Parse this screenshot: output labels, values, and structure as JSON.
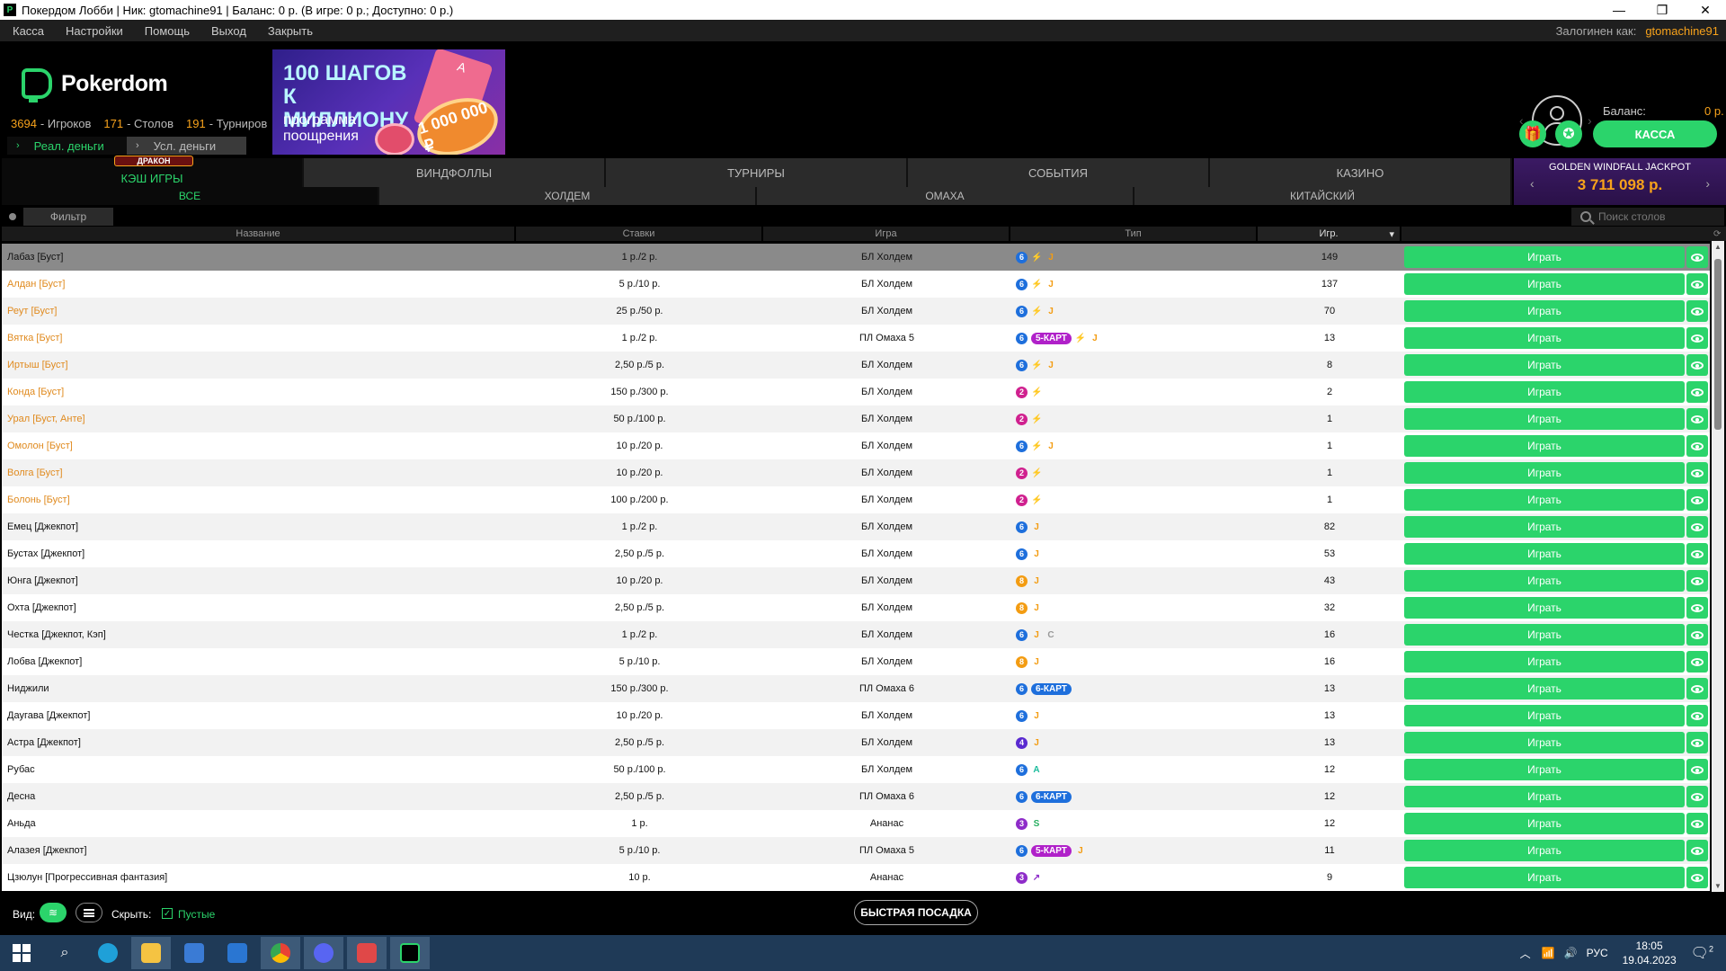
{
  "window": {
    "title": "Покердом Лобби | Ник: gtomachine91 | Баланс: 0 р. (В игре: 0 р.; Доступно: 0 р.)",
    "minimize": "—",
    "restore": "❐",
    "close": "✕"
  },
  "menu": {
    "items": [
      "Касса",
      "Настройки",
      "Помощь",
      "Выход",
      "Закрыть"
    ],
    "logged_in_label": "Залогинен как:",
    "username": "gtomachine91"
  },
  "header": {
    "logo_text": "Pokerdom",
    "stats": {
      "players_count": "3694",
      "players_label": "- Игроков",
      "tables_count": "171",
      "tables_label": "- Столов",
      "tournaments_count": "191",
      "tournaments_label": "- Турниров"
    },
    "money_tabs": [
      "Реал. деньги",
      "Усл. деньги"
    ],
    "banner": {
      "line1": "100 ШАГОВ К МИЛЛИОНУ",
      "line2": "программа поощрения",
      "chip_text": "1 000 000 ₽",
      "card_text": "A"
    },
    "balance_label": "Баланс:",
    "balance_value": "0 р.",
    "balance_bar_value": "0",
    "kassa_label": "КАССА"
  },
  "game_tabs": {
    "dragon_badge": "ДРАКОН",
    "tabs": [
      "КЭШ ИГРЫ",
      "ВИНДФОЛЛЫ",
      "ТУРНИРЫ",
      "СОБЫТИЯ",
      "КАЗИНО"
    ]
  },
  "jackpot": {
    "title": "GOLDEN WINDFALL JACKPOT",
    "value": "3 711 098 р."
  },
  "sub_tabs": [
    "ВСЕ",
    "ХОЛДЕМ",
    "ОМАХА",
    "КИТАЙСКИЙ"
  ],
  "filter": {
    "label": "Фильтр",
    "search_placeholder": "Поиск столов"
  },
  "columns": {
    "name": "Название",
    "stakes": "Ставки",
    "game": "Игра",
    "type": "Тип",
    "players": "Игр.",
    "sort_marker": "▾"
  },
  "play_label": "Играть",
  "colors": {
    "accent": "#2bd46b",
    "orange": "#f7a21b",
    "badge_blue": "#1e6fdc",
    "badge_pink": "#d0218f",
    "badge_orange": "#f39c12",
    "badge_purple": "#8e2cc9",
    "badge_indigo": "#5a2ad0"
  },
  "tables": [
    {
      "name": "Лабаз [Буст]",
      "stakes": "1 р./2 р.",
      "game": "БЛ Холдем",
      "players": "149",
      "orange": false,
      "selected": true,
      "num": "6",
      "numColor": "#1e6fdc",
      "tags": [
        {
          "t": "⚡",
          "c": "#e0392b"
        },
        {
          "t": "J",
          "c": "#f39c12"
        }
      ]
    },
    {
      "name": "Алдан [Буст]",
      "stakes": "5 р./10 р.",
      "game": "БЛ Холдем",
      "players": "137",
      "orange": true,
      "selected": false,
      "num": "6",
      "numColor": "#1e6fdc",
      "tags": [
        {
          "t": "⚡",
          "c": "#e0392b"
        },
        {
          "t": "J",
          "c": "#f39c12"
        }
      ]
    },
    {
      "name": "Реут [Буст]",
      "stakes": "25 р./50 р.",
      "game": "БЛ Холдем",
      "players": "70",
      "orange": true,
      "selected": false,
      "num": "6",
      "numColor": "#1e6fdc",
      "tags": [
        {
          "t": "⚡",
          "c": "#e0392b"
        },
        {
          "t": "J",
          "c": "#f39c12"
        }
      ]
    },
    {
      "name": "Вятка [Буст]",
      "stakes": "1 р./2 р.",
      "game": "ПЛ Омаха 5",
      "players": "13",
      "orange": true,
      "selected": false,
      "num": "6",
      "numColor": "#1e6fdc",
      "badge": {
        "t": "5-КАРТ",
        "c": "#b021c9"
      },
      "tags": [
        {
          "t": "⚡",
          "c": "#e0392b"
        },
        {
          "t": "J",
          "c": "#f39c12"
        }
      ]
    },
    {
      "name": "Иртыш [Буст]",
      "stakes": "2,50 р./5 р.",
      "game": "БЛ Холдем",
      "players": "8",
      "orange": true,
      "selected": false,
      "num": "6",
      "numColor": "#1e6fdc",
      "tags": [
        {
          "t": "⚡",
          "c": "#e0392b"
        },
        {
          "t": "J",
          "c": "#f39c12"
        }
      ]
    },
    {
      "name": "Конда [Буст]",
      "stakes": "150 р./300 р.",
      "game": "БЛ Холдем",
      "players": "2",
      "orange": true,
      "selected": false,
      "num": "2",
      "numColor": "#d0218f",
      "tags": [
        {
          "t": "⚡",
          "c": "#e0392b"
        }
      ]
    },
    {
      "name": "Урал [Буст, Анте]",
      "stakes": "50 р./100 р.",
      "game": "БЛ Холдем",
      "players": "1",
      "orange": true,
      "selected": false,
      "num": "2",
      "numColor": "#d0218f",
      "tags": [
        {
          "t": "⚡",
          "c": "#e0392b"
        }
      ]
    },
    {
      "name": "Омолон [Буст]",
      "stakes": "10 р./20 р.",
      "game": "БЛ Холдем",
      "players": "1",
      "orange": true,
      "selected": false,
      "num": "6",
      "numColor": "#1e6fdc",
      "tags": [
        {
          "t": "⚡",
          "c": "#e0392b"
        },
        {
          "t": "J",
          "c": "#f39c12"
        }
      ]
    },
    {
      "name": "Волга [Буст]",
      "stakes": "10 р./20 р.",
      "game": "БЛ Холдем",
      "players": "1",
      "orange": true,
      "selected": false,
      "num": "2",
      "numColor": "#d0218f",
      "tags": [
        {
          "t": "⚡",
          "c": "#e0392b"
        }
      ]
    },
    {
      "name": "Болонь [Буст]",
      "stakes": "100 р./200 р.",
      "game": "БЛ Холдем",
      "players": "1",
      "orange": true,
      "selected": false,
      "num": "2",
      "numColor": "#d0218f",
      "tags": [
        {
          "t": "⚡",
          "c": "#e0392b"
        }
      ]
    },
    {
      "name": "Емец [Джекпот]",
      "stakes": "1 р./2 р.",
      "game": "БЛ Холдем",
      "players": "82",
      "orange": false,
      "selected": false,
      "num": "6",
      "numColor": "#1e6fdc",
      "tags": [
        {
          "t": "J",
          "c": "#f39c12"
        }
      ]
    },
    {
      "name": "Бустах [Джекпот]",
      "stakes": "2,50 р./5 р.",
      "game": "БЛ Холдем",
      "players": "53",
      "orange": false,
      "selected": false,
      "num": "6",
      "numColor": "#1e6fdc",
      "tags": [
        {
          "t": "J",
          "c": "#f39c12"
        }
      ]
    },
    {
      "name": "Юнга [Джекпот]",
      "stakes": "10 р./20 р.",
      "game": "БЛ Холдем",
      "players": "43",
      "orange": false,
      "selected": false,
      "num": "8",
      "numColor": "#f39c12",
      "tags": [
        {
          "t": "J",
          "c": "#f39c12"
        }
      ]
    },
    {
      "name": "Охта [Джекпот]",
      "stakes": "2,50 р./5 р.",
      "game": "БЛ Холдем",
      "players": "32",
      "orange": false,
      "selected": false,
      "num": "8",
      "numColor": "#f39c12",
      "tags": [
        {
          "t": "J",
          "c": "#f39c12"
        }
      ]
    },
    {
      "name": "Честка [Джекпот, Кэп]",
      "stakes": "1 р./2 р.",
      "game": "БЛ Холдем",
      "players": "16",
      "orange": false,
      "selected": false,
      "num": "6",
      "numColor": "#1e6fdc",
      "tags": [
        {
          "t": "J",
          "c": "#f39c12"
        },
        {
          "t": "C",
          "c": "#999999"
        }
      ]
    },
    {
      "name": "Лобва [Джекпот]",
      "stakes": "5 р./10 р.",
      "game": "БЛ Холдем",
      "players": "16",
      "orange": false,
      "selected": false,
      "num": "8",
      "numColor": "#f39c12",
      "tags": [
        {
          "t": "J",
          "c": "#f39c12"
        }
      ]
    },
    {
      "name": "Ниджили",
      "stakes": "150 р./300 р.",
      "game": "ПЛ Омаха 6",
      "players": "13",
      "orange": false,
      "selected": false,
      "num": "6",
      "numColor": "#1e6fdc",
      "badge": {
        "t": "6-КАРТ",
        "c": "#1e6fdc"
      },
      "tags": []
    },
    {
      "name": "Даугава [Джекпот]",
      "stakes": "10 р./20 р.",
      "game": "БЛ Холдем",
      "players": "13",
      "orange": false,
      "selected": false,
      "num": "6",
      "numColor": "#1e6fdc",
      "tags": [
        {
          "t": "J",
          "c": "#f39c12"
        }
      ]
    },
    {
      "name": "Астра [Джекпот]",
      "stakes": "2,50 р./5 р.",
      "game": "БЛ Холдем",
      "players": "13",
      "orange": false,
      "selected": false,
      "num": "4",
      "numColor": "#5a2ad0",
      "tags": [
        {
          "t": "J",
          "c": "#f39c12"
        }
      ]
    },
    {
      "name": "Рубас",
      "stakes": "50 р./100 р.",
      "game": "БЛ Холдем",
      "players": "12",
      "orange": false,
      "selected": false,
      "num": "6",
      "numColor": "#1e6fdc",
      "tags": [
        {
          "t": "A",
          "c": "#1abc9c"
        }
      ]
    },
    {
      "name": "Десна",
      "stakes": "2,50 р./5 р.",
      "game": "ПЛ Омаха 6",
      "players": "12",
      "orange": false,
      "selected": false,
      "num": "6",
      "numColor": "#1e6fdc",
      "badge": {
        "t": "6-КАРТ",
        "c": "#1e6fdc"
      },
      "tags": []
    },
    {
      "name": "Аньда",
      "stakes": "1 р.",
      "game": "Ананас",
      "players": "12",
      "orange": false,
      "selected": false,
      "num": "3",
      "numColor": "#8e2cc9",
      "tags": [
        {
          "t": "S",
          "c": "#27ae60"
        }
      ]
    },
    {
      "name": "Алазея [Джекпот]",
      "stakes": "5 р./10 р.",
      "game": "ПЛ Омаха 5",
      "players": "11",
      "orange": false,
      "selected": false,
      "num": "6",
      "numColor": "#1e6fdc",
      "badge": {
        "t": "5-КАРТ",
        "c": "#b021c9"
      },
      "tags": [
        {
          "t": "J",
          "c": "#f39c12"
        }
      ]
    },
    {
      "name": "Цзюлун [Прогрессивная фантазия]",
      "stakes": "10 р.",
      "game": "Ананас",
      "players": "9",
      "orange": false,
      "selected": false,
      "num": "3",
      "numColor": "#8e2cc9",
      "tags": [
        {
          "t": "↗",
          "c": "#8e2cc9"
        }
      ]
    }
  ],
  "bottom": {
    "view_label": "Вид:",
    "hide_label": "Скрыть:",
    "empty_label": "Пустые",
    "quick_seat": "БЫСТРАЯ ПОСАДКА"
  },
  "taskbar": {
    "lang": "РУС",
    "time": "18:05",
    "date": "19.04.2023",
    "notifications": "2"
  }
}
